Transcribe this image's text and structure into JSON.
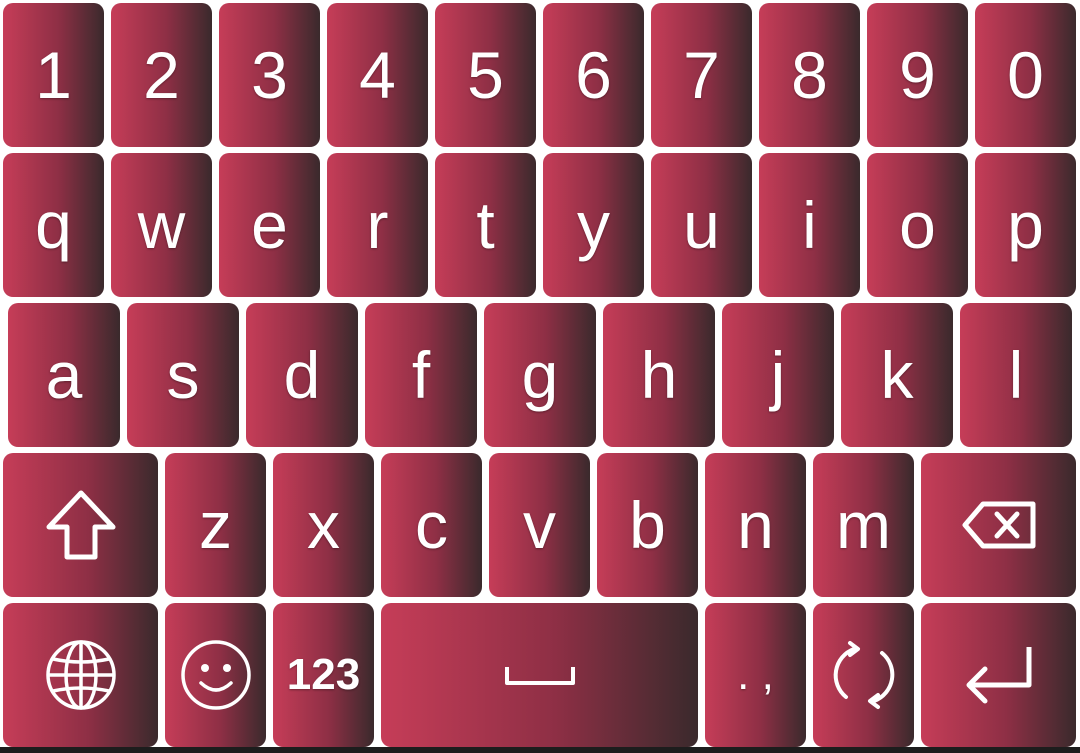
{
  "keyboard": {
    "colors": {
      "key_gradient_start": "#c63d58",
      "key_gradient_mid": "#8e2f45",
      "key_gradient_end": "#3a2a2c",
      "label": "#ffffff",
      "background": "#ffffff"
    },
    "number_row": [
      "1",
      "2",
      "3",
      "4",
      "5",
      "6",
      "7",
      "8",
      "9",
      "0"
    ],
    "top_row": [
      "q",
      "w",
      "e",
      "r",
      "t",
      "y",
      "u",
      "i",
      "o",
      "p"
    ],
    "home_row": [
      "a",
      "s",
      "d",
      "f",
      "g",
      "h",
      "j",
      "k",
      "l"
    ],
    "bottom_row": {
      "shift_icon": "shift-arrow-icon",
      "letters": [
        "z",
        "x",
        "c",
        "v",
        "b",
        "n",
        "m"
      ],
      "backspace_icon": "backspace-icon"
    },
    "function_row": {
      "language_icon": "globe-icon",
      "emoji_icon": "smiley-icon",
      "numbers_label": "123",
      "space_icon": "space-bar-icon",
      "punctuation_label": ". ,",
      "switch_icon": "rotate-arrows-icon",
      "enter_icon": "enter-arrow-icon"
    }
  }
}
